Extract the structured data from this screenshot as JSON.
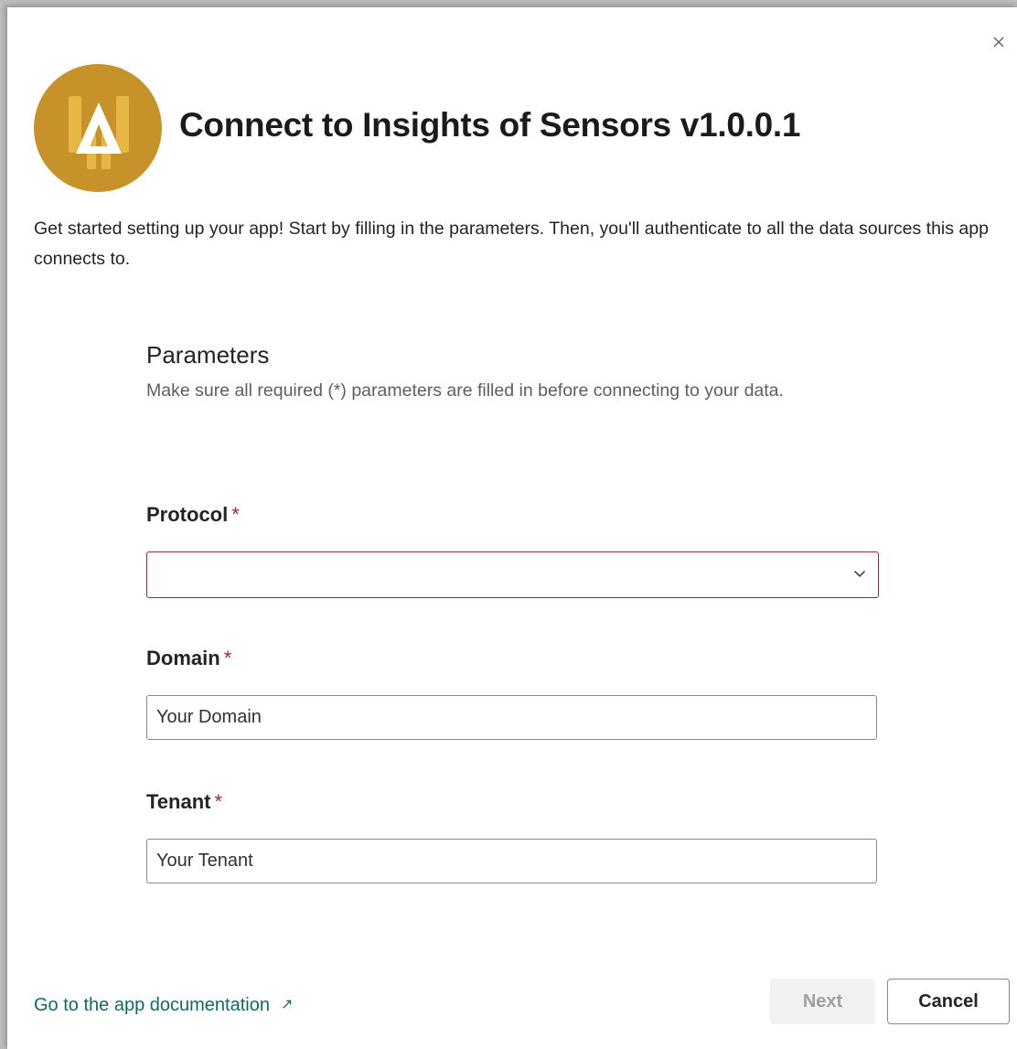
{
  "dialog": {
    "title": "Connect to Insights of Sensors v1.0.0.1",
    "intro": "Get started setting up your app! Start by filling in the parameters. Then, you'll authenticate to all the data sources this app connects to.",
    "close_icon": "close-icon",
    "logo_icon": "app-logo"
  },
  "parameters": {
    "title": "Parameters",
    "description": "Make sure all required (*) parameters are filled in before connecting to your data."
  },
  "fields": {
    "protocol": {
      "label": "Protocol",
      "required_mark": "*",
      "value": "",
      "chevron_icon": "chevron-down-icon"
    },
    "domain": {
      "label": "Domain",
      "required_mark": "*",
      "placeholder": "Your Domain"
    },
    "tenant": {
      "label": "Tenant",
      "required_mark": "*",
      "placeholder": "Your Tenant"
    }
  },
  "footer": {
    "doc_link": "Go to the app documentation",
    "doc_link_icon_glyph": "↗",
    "next_label": "Next",
    "cancel_label": "Cancel"
  },
  "colors": {
    "logo": "#c8922a",
    "required": "#a4262c",
    "link": "#0f6b5e"
  }
}
